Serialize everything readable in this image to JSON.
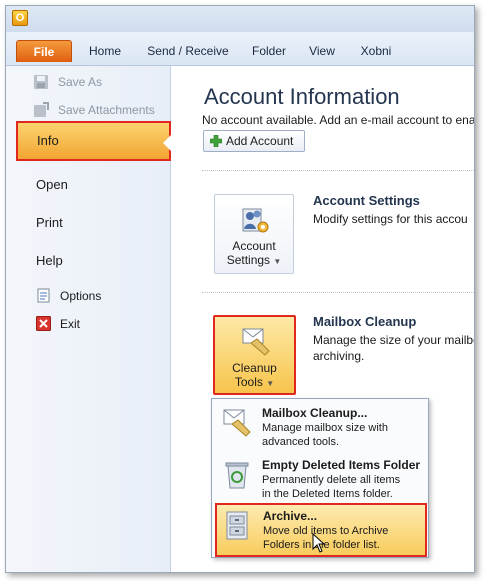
{
  "titlebar": {
    "app_icon_letter": "O"
  },
  "ribbon": {
    "tabs": [
      {
        "label": "File"
      },
      {
        "label": "Home"
      },
      {
        "label": "Send / Receive"
      },
      {
        "label": "Folder"
      },
      {
        "label": "View"
      },
      {
        "label": "Xobni"
      }
    ]
  },
  "sidebar": {
    "save_as": "Save As",
    "save_attachments": "Save Attachments",
    "info": "Info",
    "open": "Open",
    "print": "Print",
    "help": "Help",
    "options": "Options",
    "exit": "Exit"
  },
  "main": {
    "title": "Account Information",
    "no_account_text": "No account available. Add an e-mail account to ena",
    "add_account_label": "Add Account",
    "account_settings": {
      "button_line1": "Account",
      "button_line2": "Settings",
      "title": "Account Settings",
      "description": "Modify settings for this accou"
    },
    "mailbox_cleanup": {
      "button_line1": "Cleanup",
      "button_line2": "Tools",
      "title": "Mailbox Cleanup",
      "description_line1": "Manage the size of your mailbo",
      "description_line2": "archiving."
    }
  },
  "dropdown": {
    "items": [
      {
        "title": "Mailbox Cleanup...",
        "desc_line1": "Manage mailbox size with",
        "desc_line2": "advanced tools."
      },
      {
        "title": "Empty Deleted Items Folder",
        "desc_line1": "Permanently delete all items",
        "desc_line2": "in the Deleted Items folder."
      },
      {
        "title": "Archive...",
        "desc_line1": "Move old items to Archive",
        "desc_line2": "Folders in the folder list."
      }
    ]
  },
  "colors": {
    "file_tab": "#e05e10",
    "highlight_border": "#e0281e",
    "selected_item": "#f2a531"
  }
}
